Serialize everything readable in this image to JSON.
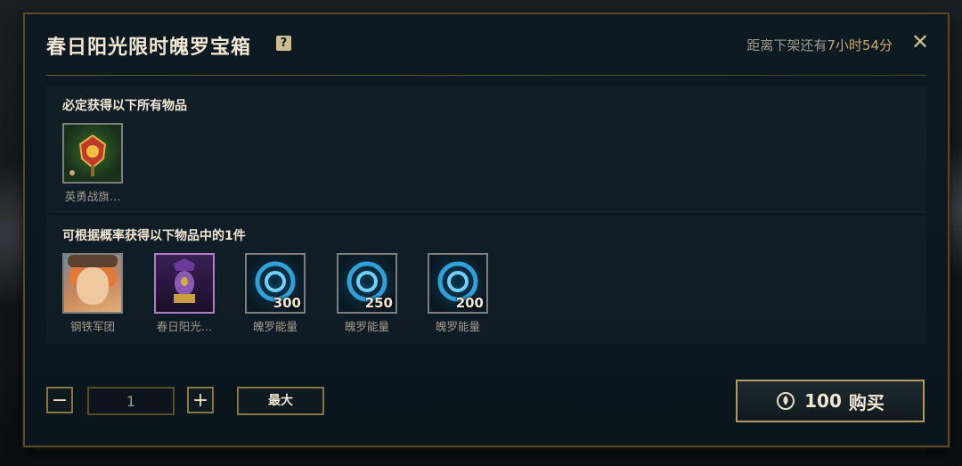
{
  "header": {
    "title": "春日阳光限时魄罗宝箱",
    "help_glyph": "?",
    "timer_prefix": "距离下架还有",
    "timer_value": "7小时54分",
    "close_glyph": "✕"
  },
  "guaranteed": {
    "title": "必定获得以下所有物品",
    "items": [
      {
        "label": "英勇战旗…",
        "icon": "ward-banner-icon"
      }
    ]
  },
  "chance": {
    "title": "可根据概率获得以下物品中的1件",
    "items": [
      {
        "label": "钢铁军团",
        "icon": "champion-skin-icon",
        "qty": ""
      },
      {
        "label": "春日阳光…",
        "icon": "purple-item-icon",
        "qty": ""
      },
      {
        "label": "魄罗能量",
        "icon": "essence-icon",
        "qty": "300"
      },
      {
        "label": "魄罗能量",
        "icon": "essence-icon",
        "qty": "250"
      },
      {
        "label": "魄罗能量",
        "icon": "essence-icon",
        "qty": "200"
      }
    ]
  },
  "controls": {
    "minus": "−",
    "quantity": "1",
    "plus": "+",
    "max_label": "最大"
  },
  "buy": {
    "price": "100",
    "label": "购买",
    "currency_icon": "poro-coin-icon"
  },
  "colors": {
    "gold": "#c8aa6e",
    "border_gold": "#5b4a25",
    "text_light": "#f0e6d2",
    "text_muted": "#a09b8c"
  }
}
